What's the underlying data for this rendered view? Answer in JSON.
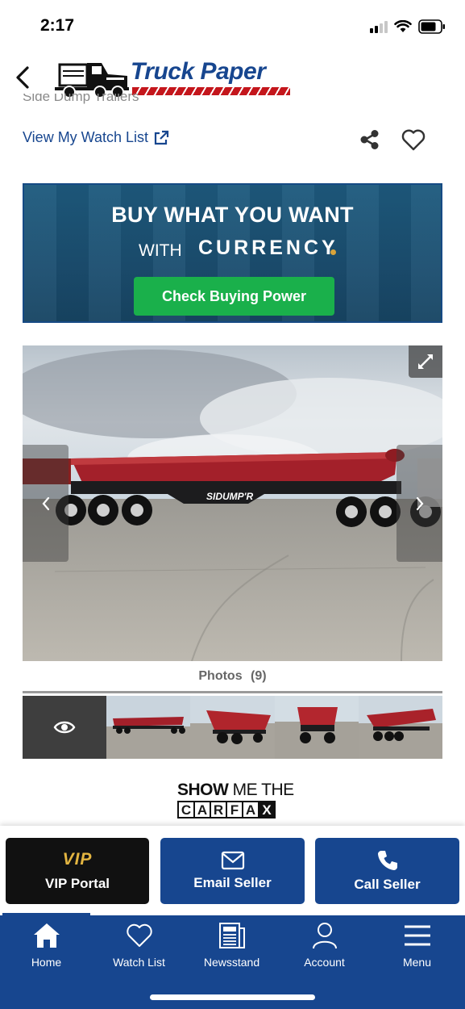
{
  "status_bar": {
    "time": "2:17"
  },
  "header": {
    "logo_text": "Truck Paper"
  },
  "listing": {
    "category_cut": "Side Dump Trailers",
    "watch_list_link": "View My Watch List"
  },
  "banner": {
    "headline": "BUY WHAT YOU WANT",
    "with": "WITH",
    "brand": "CURRENCY",
    "cta": "Check Buying Power"
  },
  "gallery": {
    "trailer_brand_text": "SIDUMP'R",
    "photos_label": "Photos",
    "photos_count": "(9)"
  },
  "carfax": {
    "line1_bold": "SHOW",
    "line1_thin": "ME THE",
    "letters": [
      "C",
      "A",
      "R",
      "F",
      "A",
      "X"
    ]
  },
  "actions": {
    "vip_logo": "VIP",
    "vip_label": "VIP Portal",
    "email_label": "Email Seller",
    "call_label": "Call Seller"
  },
  "tabs": [
    {
      "label": "Home",
      "icon": "home-icon"
    },
    {
      "label": "Watch List",
      "icon": "heart-icon"
    },
    {
      "label": "Newsstand",
      "icon": "newspaper-icon"
    },
    {
      "label": "Account",
      "icon": "person-icon"
    },
    {
      "label": "Menu",
      "icon": "menu-icon"
    }
  ],
  "colors": {
    "brand_blue": "#17468f",
    "brand_red": "#c4161c",
    "cta_green": "#1ab04b",
    "vip_gold": "#e3b541"
  }
}
